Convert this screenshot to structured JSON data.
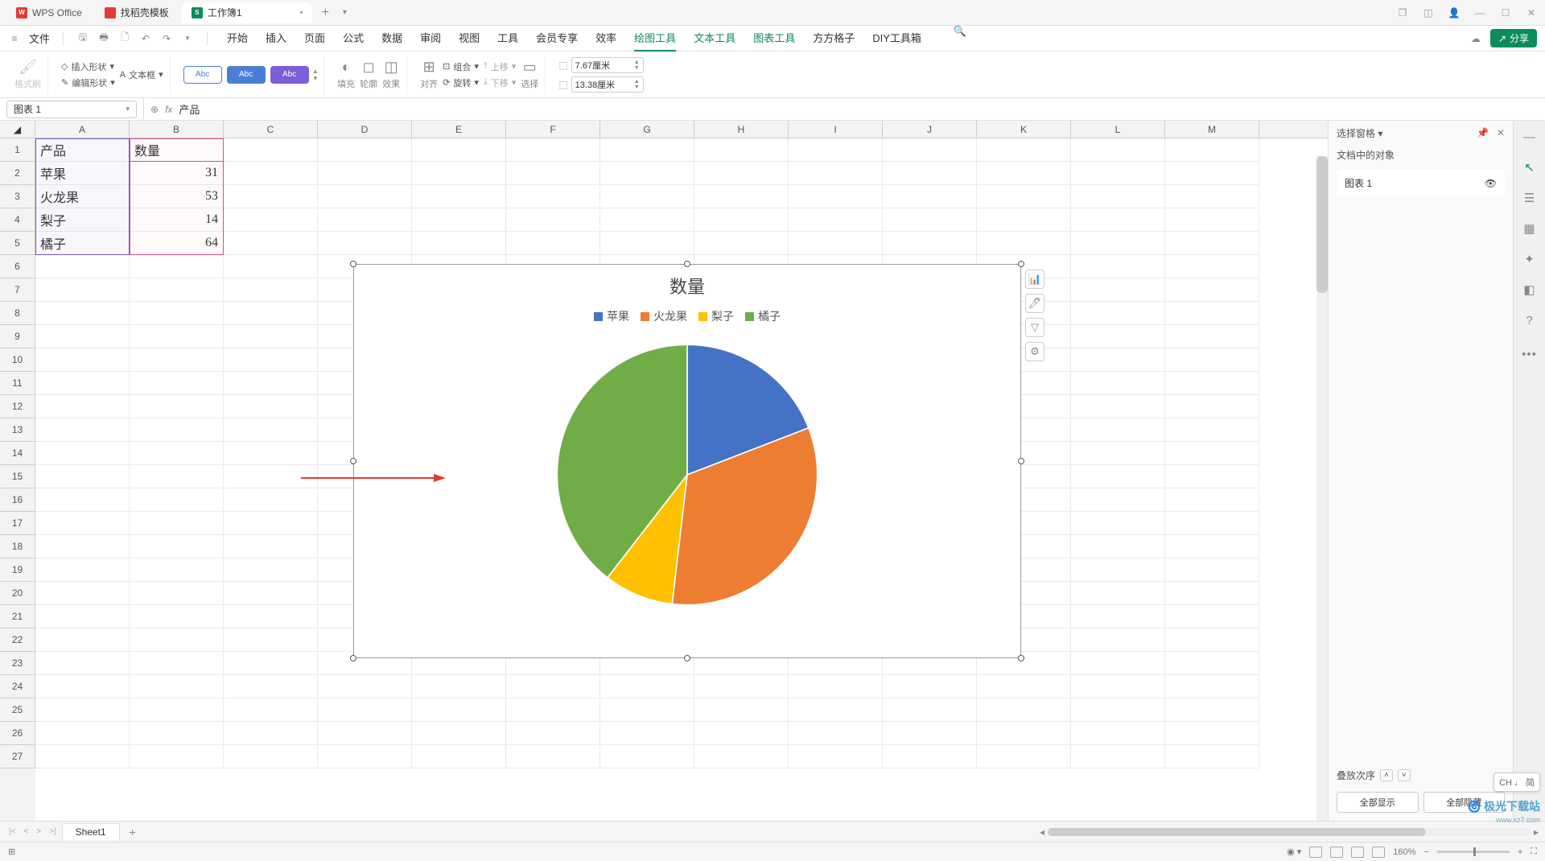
{
  "titlebar": {
    "tab_wps": "WPS Office",
    "tab_templates": "找稻壳模板",
    "tab_workbook": "工作簿1"
  },
  "menubar": {
    "file": "文件",
    "tabs": [
      "开始",
      "插入",
      "页面",
      "公式",
      "数据",
      "审阅",
      "视图",
      "工具",
      "会员专享",
      "效率",
      "绘图工具",
      "文本工具",
      "图表工具",
      "方方格子",
      "DIY工具箱"
    ],
    "active_tab": "绘图工具",
    "share": "分享"
  },
  "ribbon": {
    "format_painter": "格式刷",
    "insert_shape": "插入形状",
    "edit_shape": "编辑形状",
    "text_box": "文本框",
    "style_label": "Abc",
    "fill": "填充",
    "outline": "轮廓",
    "effects": "效果",
    "align": "对齐",
    "group": "组合",
    "rotate": "旋转",
    "move_up": "上移",
    "move_down": "下移",
    "select": "选择",
    "width": "7.67厘米",
    "height": "13.38厘米"
  },
  "formula_bar": {
    "name_box": "图表 1",
    "formula": "产品"
  },
  "columns": [
    "A",
    "B",
    "C",
    "D",
    "E",
    "F",
    "G",
    "H",
    "I",
    "J",
    "K",
    "L",
    "M"
  ],
  "rows_data": [
    {
      "a": "产品",
      "b": "数量"
    },
    {
      "a": "苹果",
      "b": "31"
    },
    {
      "a": "火龙果",
      "b": "53"
    },
    {
      "a": "梨子",
      "b": "14"
    },
    {
      "a": "橘子",
      "b": "64"
    }
  ],
  "chart_data": {
    "type": "pie",
    "title": "数量",
    "categories": [
      "苹果",
      "火龙果",
      "梨子",
      "橘子"
    ],
    "values": [
      31,
      53,
      14,
      64
    ],
    "colors": [
      "#4472c4",
      "#ed7d31",
      "#ffc000",
      "#70ad47"
    ]
  },
  "right_panel": {
    "title": "选择窗格",
    "subtitle": "文档中的对象",
    "item1": "图表 1",
    "stack_order": "叠放次序",
    "show_all": "全部显示",
    "hide_all": "全部隐藏"
  },
  "sheet_tabs": {
    "sheet1": "Sheet1"
  },
  "statusbar": {
    "zoom": "160%"
  },
  "ime": "CH ♩ 简",
  "watermark": {
    "brand": "极光下载站",
    "url": "www.xz7.com"
  }
}
